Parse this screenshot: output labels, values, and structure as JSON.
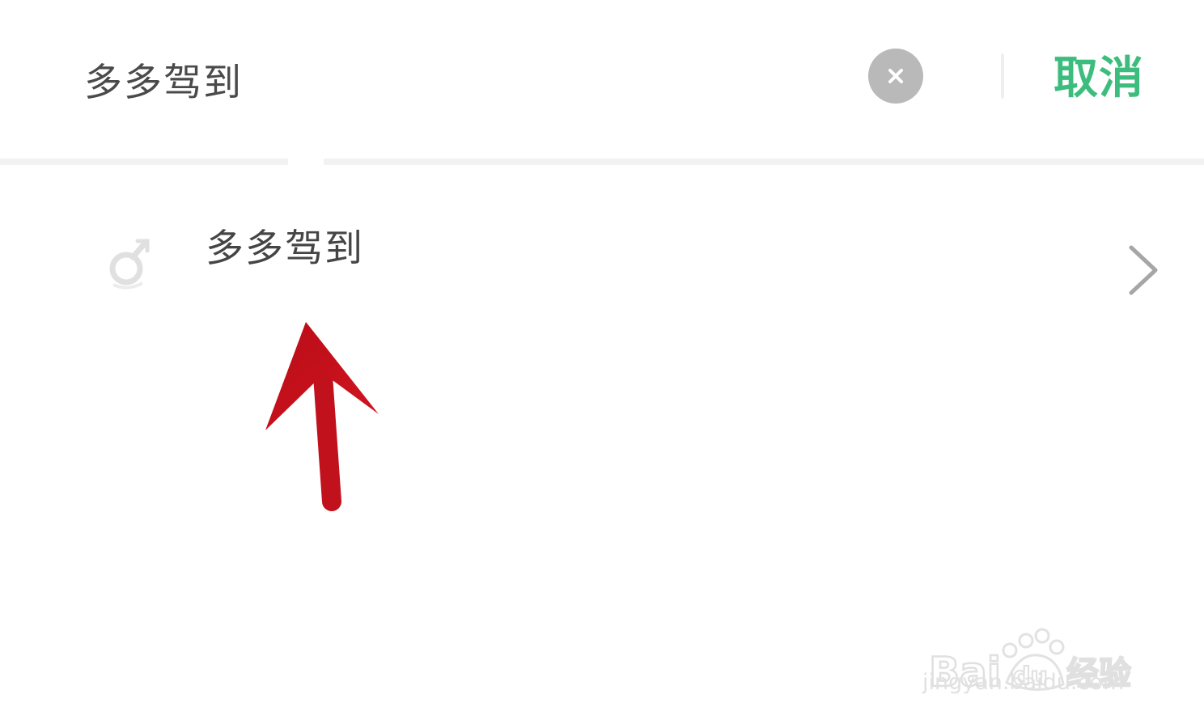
{
  "search": {
    "value": "多多驾到",
    "clear_icon": "close-circle-icon",
    "cancel_label": "取消",
    "cancel_color": "#3dbd7d"
  },
  "results": [
    {
      "label": "多多驾到",
      "icon": "mini-program-icon",
      "trailing_icon": "chevron-right-icon"
    }
  ],
  "annotation": {
    "icon": "red-arrow-up-icon",
    "color": "#c0111c"
  },
  "watermark": {
    "logo_text": "Baidu经验",
    "url": "jingyan.baidu.com"
  }
}
